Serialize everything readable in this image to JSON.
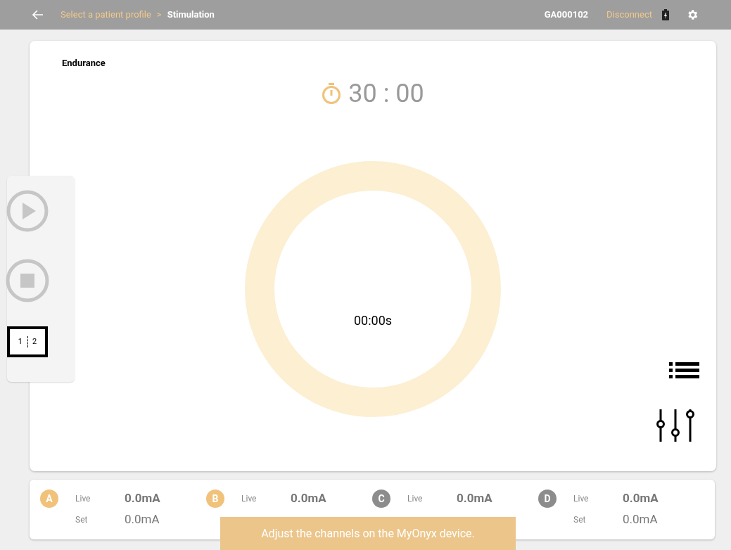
{
  "top_bar": {
    "breadcrumb": [
      {
        "label": "Select a patient profile",
        "selected": false
      },
      {
        "label": "Stimulation",
        "selected": true
      }
    ],
    "separator": ">",
    "device_id": "GA000102",
    "disconnect": "Disconnect"
  },
  "program": {
    "name": "Endurance",
    "timer": "30 : 00",
    "elapsed": "00:00s"
  },
  "side_panel": {
    "split_labels": [
      "1",
      "2"
    ]
  },
  "channels": [
    {
      "letter": "A",
      "color": "#f0c27a",
      "live_label": "Live",
      "live": "0.0mA",
      "set_label": "Set",
      "set": "0.0mA"
    },
    {
      "letter": "B",
      "color": "#f0c27a",
      "live_label": "Live",
      "live": "0.0mA"
    },
    {
      "letter": "C",
      "color": "#8c8c8c",
      "live_label": "Live",
      "live": "0.0mA"
    },
    {
      "letter": "D",
      "color": "#8c8c8c",
      "live_label": "Live",
      "live": "0.0mA",
      "set_label": "Set",
      "set": "0.0mA"
    }
  ],
  "toast": "Adjust the channels on the MyOnyx device."
}
